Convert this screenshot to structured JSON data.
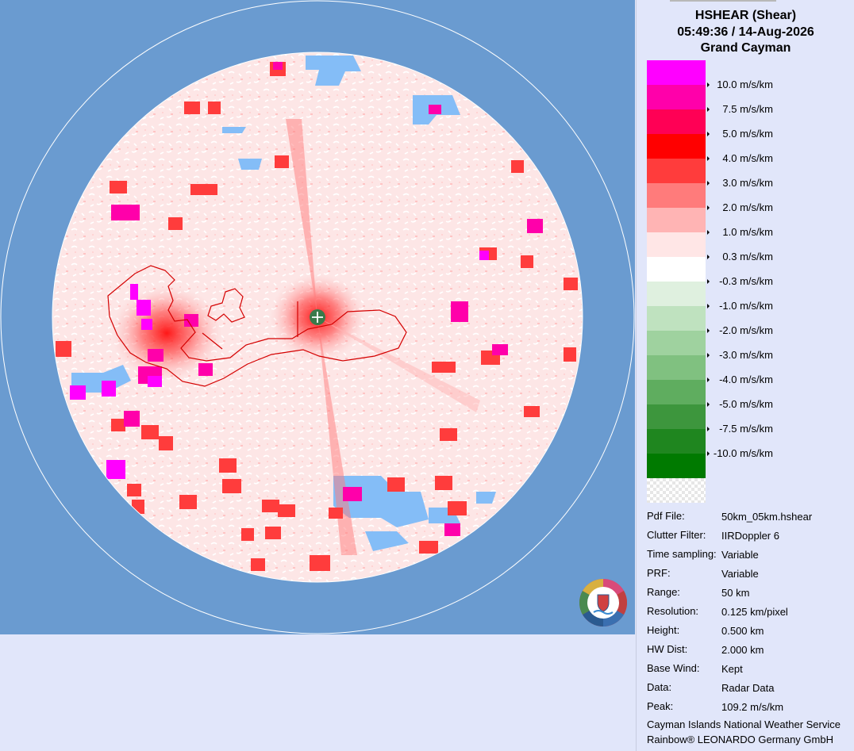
{
  "header": {
    "title": "HSHEAR (Shear)",
    "datetime": "05:49:36 / 14-Aug-2026",
    "site": "Grand Cayman"
  },
  "legend": [
    {
      "label": "10.0 m/s/km",
      "color": "#ff00ff"
    },
    {
      "label": "7.5 m/s/km",
      "color": "#ff00aa"
    },
    {
      "label": "5.0 m/s/km",
      "color": "#ff0055"
    },
    {
      "label": "4.0 m/s/km",
      "color": "#ff0000"
    },
    {
      "label": "3.0 m/s/km",
      "color": "#ff3c3c"
    },
    {
      "label": "2.0 m/s/km",
      "color": "#ff7b7b"
    },
    {
      "label": "1.0 m/s/km",
      "color": "#ffb4b4"
    },
    {
      "label": "0.3 m/s/km",
      "color": "#ffe6e6"
    },
    {
      "label": "-0.3 m/s/km",
      "color": "#ffffff"
    },
    {
      "label": "-1.0 m/s/km",
      "color": "#dff0df"
    },
    {
      "label": "-2.0 m/s/km",
      "color": "#bfe2bf"
    },
    {
      "label": "-3.0 m/s/km",
      "color": "#9fd29f"
    },
    {
      "label": "-4.0 m/s/km",
      "color": "#80c180"
    },
    {
      "label": "-5.0 m/s/km",
      "color": "#5fad5f"
    },
    {
      "label": "-7.5 m/s/km",
      "color": "#3d963d"
    },
    {
      "label": "-10.0 m/s/km",
      "color": "#1f861f"
    },
    {
      "label": "",
      "color": "#007a00"
    }
  ],
  "info": [
    {
      "key": "Pdf File:",
      "value": "50km_05km.hshear"
    },
    {
      "key": "Clutter Filter:",
      "value": "IIRDoppler 6"
    },
    {
      "key": "Time sampling:",
      "value": "Variable"
    },
    {
      "key": "PRF:",
      "value": "Variable"
    },
    {
      "key": "Range:",
      "value": "50 km"
    },
    {
      "key": "Resolution:",
      "value": "0.125 km/pixel"
    },
    {
      "key": "Height:",
      "value": "0.500 km"
    },
    {
      "key": "HW Dist:",
      "value": "2.000 km"
    },
    {
      "key": "Base Wind:",
      "value": "Kept"
    },
    {
      "key": "Data:",
      "value": "Radar Data"
    },
    {
      "key": "Peak:",
      "value": "109.2 m/s/km"
    }
  ],
  "credits": {
    "line1": "Cayman Islands National Weather Service",
    "line2": "Rainbow® LEONARDO Germany GmbH"
  },
  "colors": {
    "background_sea": "#6a9bd0",
    "panel": "#e1e6fa",
    "radar_base": "#fde6e6",
    "no_echo_land": "#84bdf7",
    "coastline": "#d40000",
    "radar_site": "#3a7a4a"
  },
  "icons": {
    "radar_site": "radar-site-icon",
    "logo": "weather-service-logo"
  }
}
